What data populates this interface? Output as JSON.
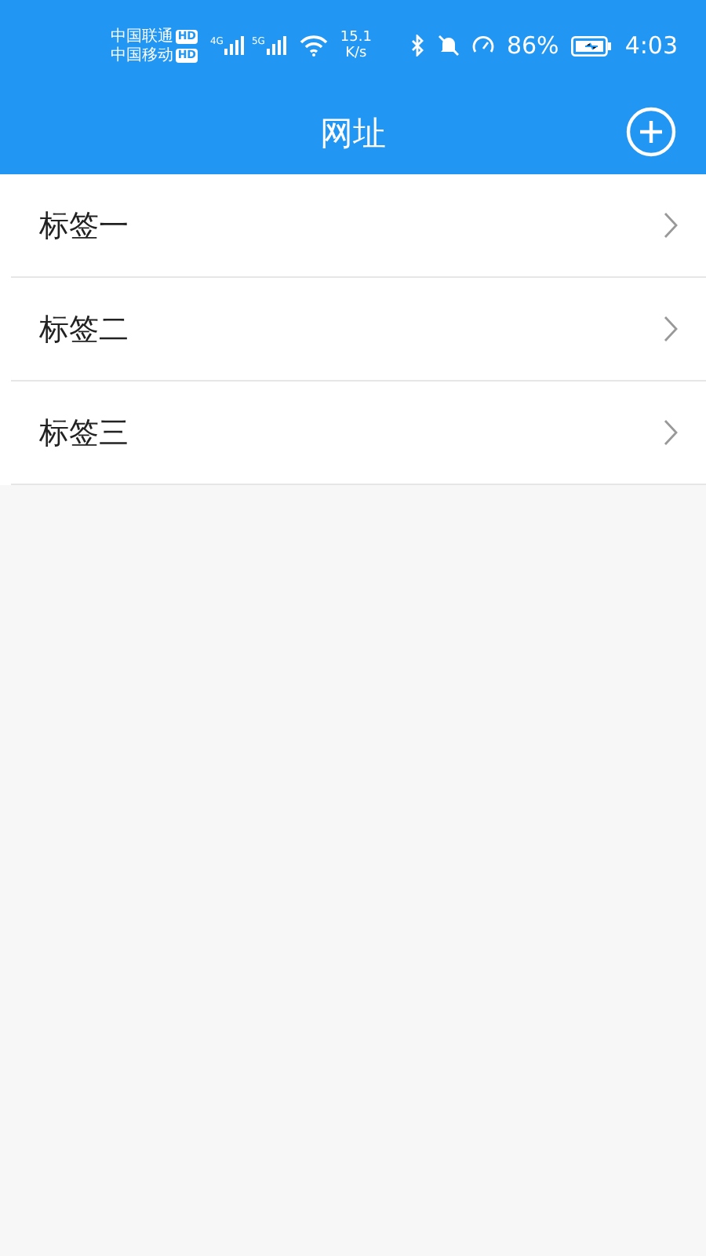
{
  "status_bar": {
    "carriers": [
      {
        "name": "中国联通",
        "badge": "HD",
        "network": "4G"
      },
      {
        "name": "中国移动",
        "badge": "HD",
        "network": "5G"
      }
    ],
    "speed": "15.1",
    "speed_unit": "K/s",
    "battery": "86%",
    "time": "4:03"
  },
  "header": {
    "title": "网址"
  },
  "items": [
    {
      "label": "标签一"
    },
    {
      "label": "标签二"
    },
    {
      "label": "标签三"
    }
  ]
}
